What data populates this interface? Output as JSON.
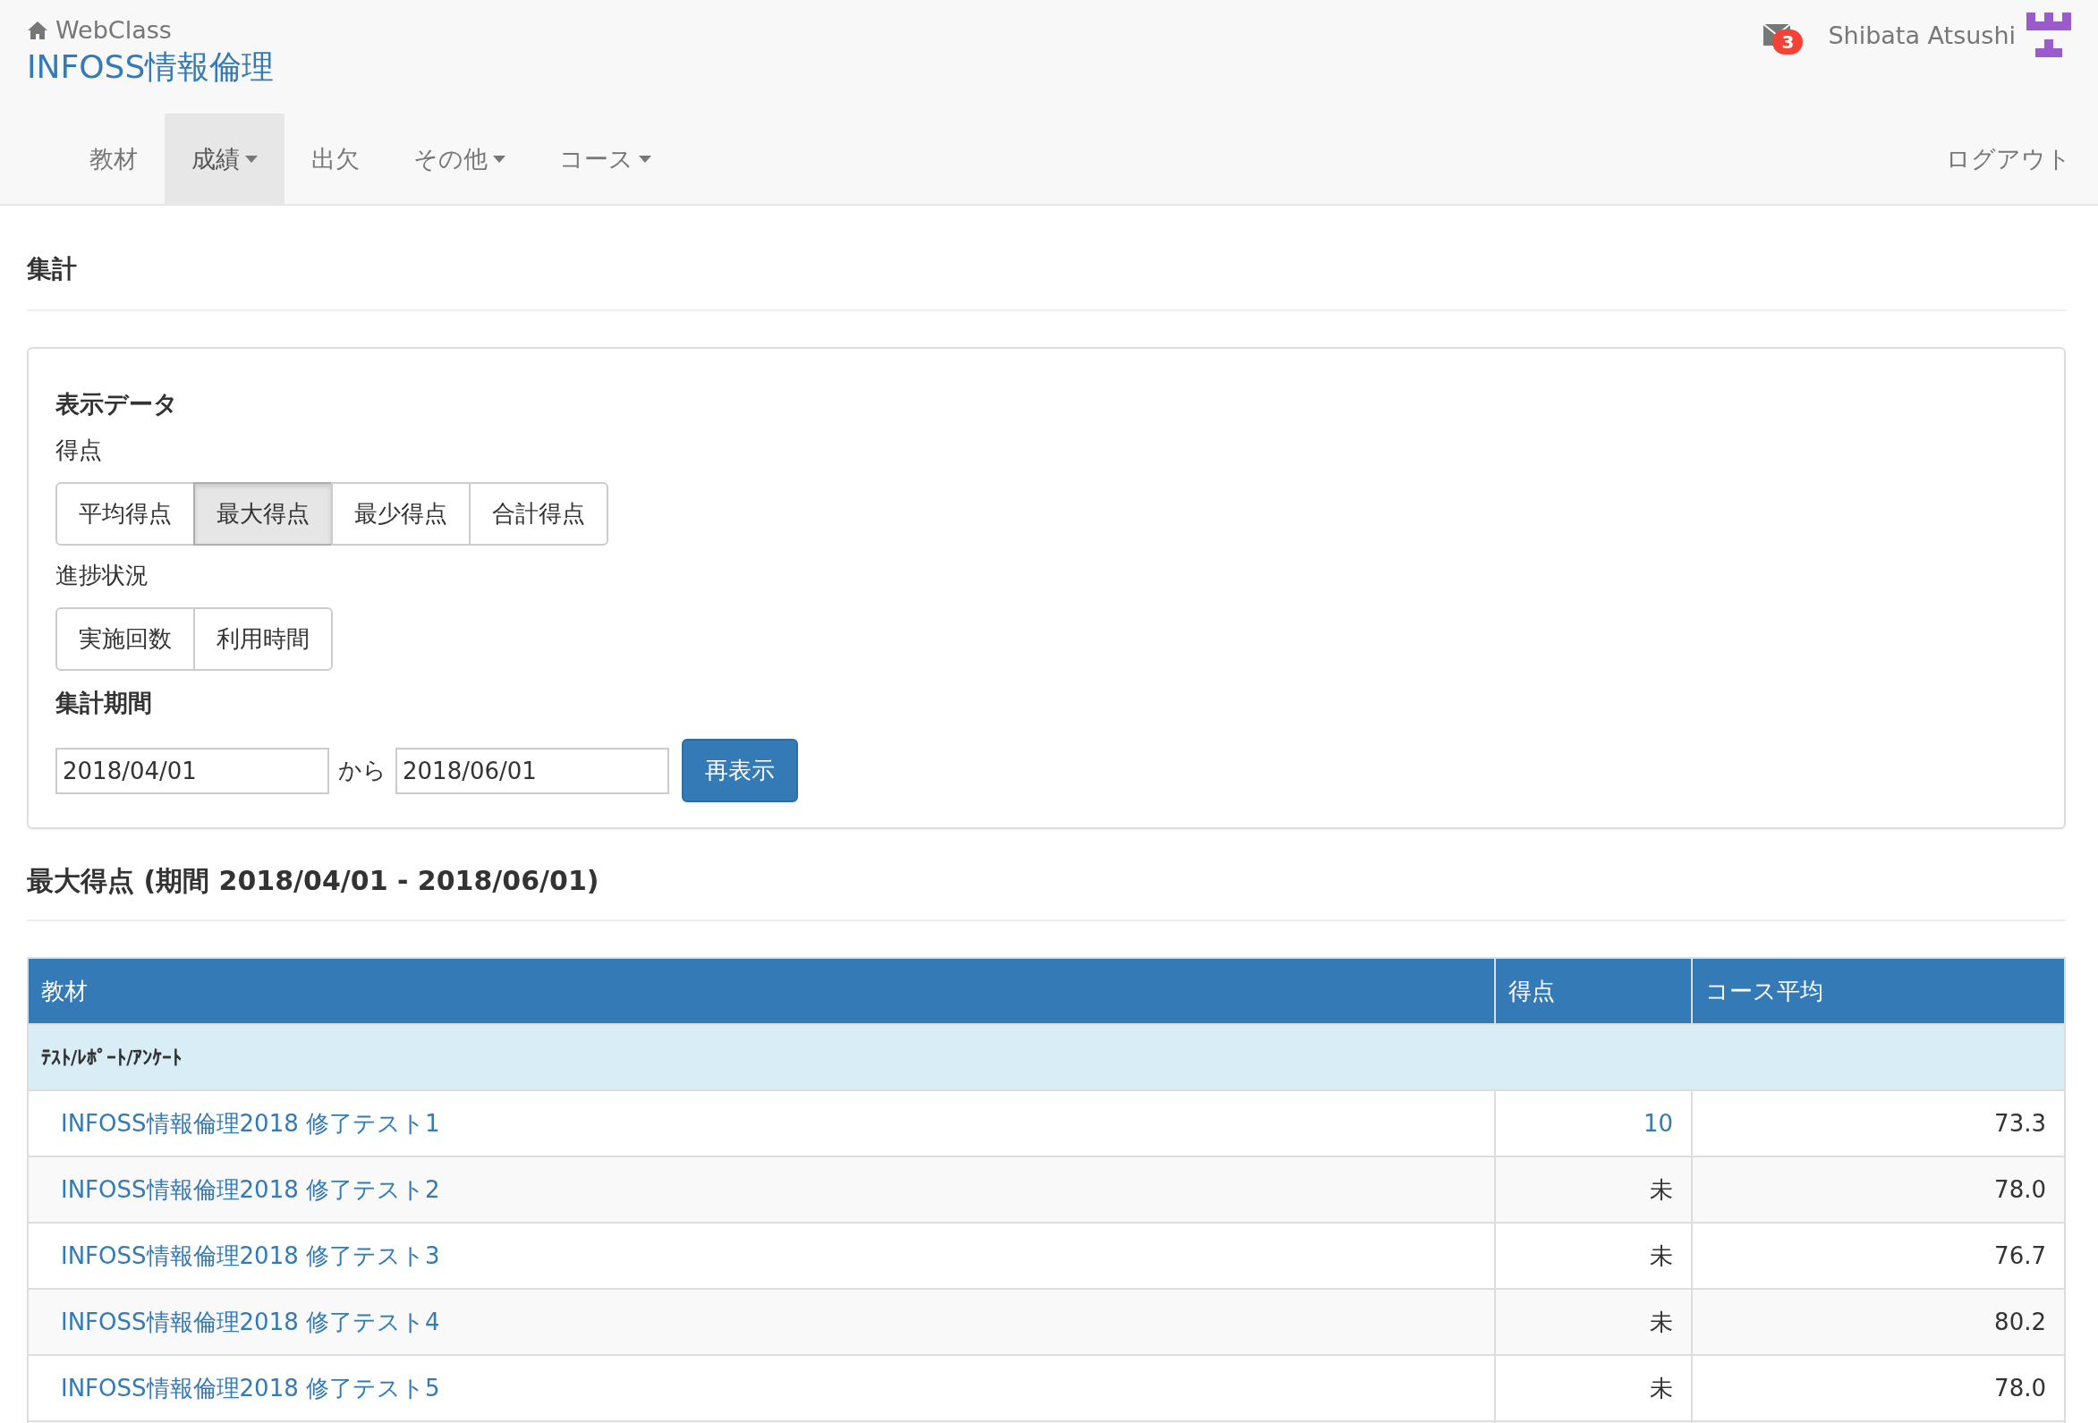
{
  "header": {
    "home_label": "WebClass",
    "course_title": "INFOSS情報倫理",
    "mail_badge": "3",
    "user_name": "Shibata Atsushi"
  },
  "nav": {
    "items": [
      {
        "label": "教材",
        "selected": false,
        "dropdown": false
      },
      {
        "label": "成績",
        "selected": true,
        "dropdown": true
      },
      {
        "label": "出欠",
        "selected": false,
        "dropdown": false
      },
      {
        "label": "その他",
        "selected": false,
        "dropdown": true
      },
      {
        "label": "コース",
        "selected": false,
        "dropdown": true
      }
    ],
    "logout": "ログアウト"
  },
  "page_title": "集計",
  "panel": {
    "title": "表示データ",
    "groups": [
      {
        "label": "得点",
        "options": [
          {
            "label": "平均得点",
            "selected": false
          },
          {
            "label": "最大得点",
            "selected": true
          },
          {
            "label": "最少得点",
            "selected": false
          },
          {
            "label": "合計得点",
            "selected": false
          }
        ]
      },
      {
        "label": "進捗状況",
        "options": [
          {
            "label": "実施回数",
            "selected": false
          },
          {
            "label": "利用時間",
            "selected": false
          }
        ]
      }
    ],
    "period_label": "集計期間",
    "from": "2018/04/01",
    "between": "から",
    "to": "2018/06/01",
    "submit": "再表示"
  },
  "result_title": "最大得点 (期間 2018/04/01 - 2018/06/01)",
  "table": {
    "columns": [
      "教材",
      "得点",
      "コース平均"
    ],
    "category": "ﾃｽﾄ/ﾚﾎﾟｰﾄ/ｱﾝｹｰﾄ",
    "rows": [
      {
        "material": "INFOSS情報倫理2018 修了テスト1",
        "score": "10",
        "score_linked": true,
        "average": "73.3"
      },
      {
        "material": "INFOSS情報倫理2018 修了テスト2",
        "score": "未",
        "score_linked": false,
        "average": "78.0"
      },
      {
        "material": "INFOSS情報倫理2018 修了テスト3",
        "score": "未",
        "score_linked": false,
        "average": "76.7"
      },
      {
        "material": "INFOSS情報倫理2018 修了テスト4",
        "score": "未",
        "score_linked": false,
        "average": "80.2"
      },
      {
        "material": "INFOSS情報倫理2018 修了テスト5",
        "score": "未",
        "score_linked": false,
        "average": "78.0"
      }
    ]
  }
}
